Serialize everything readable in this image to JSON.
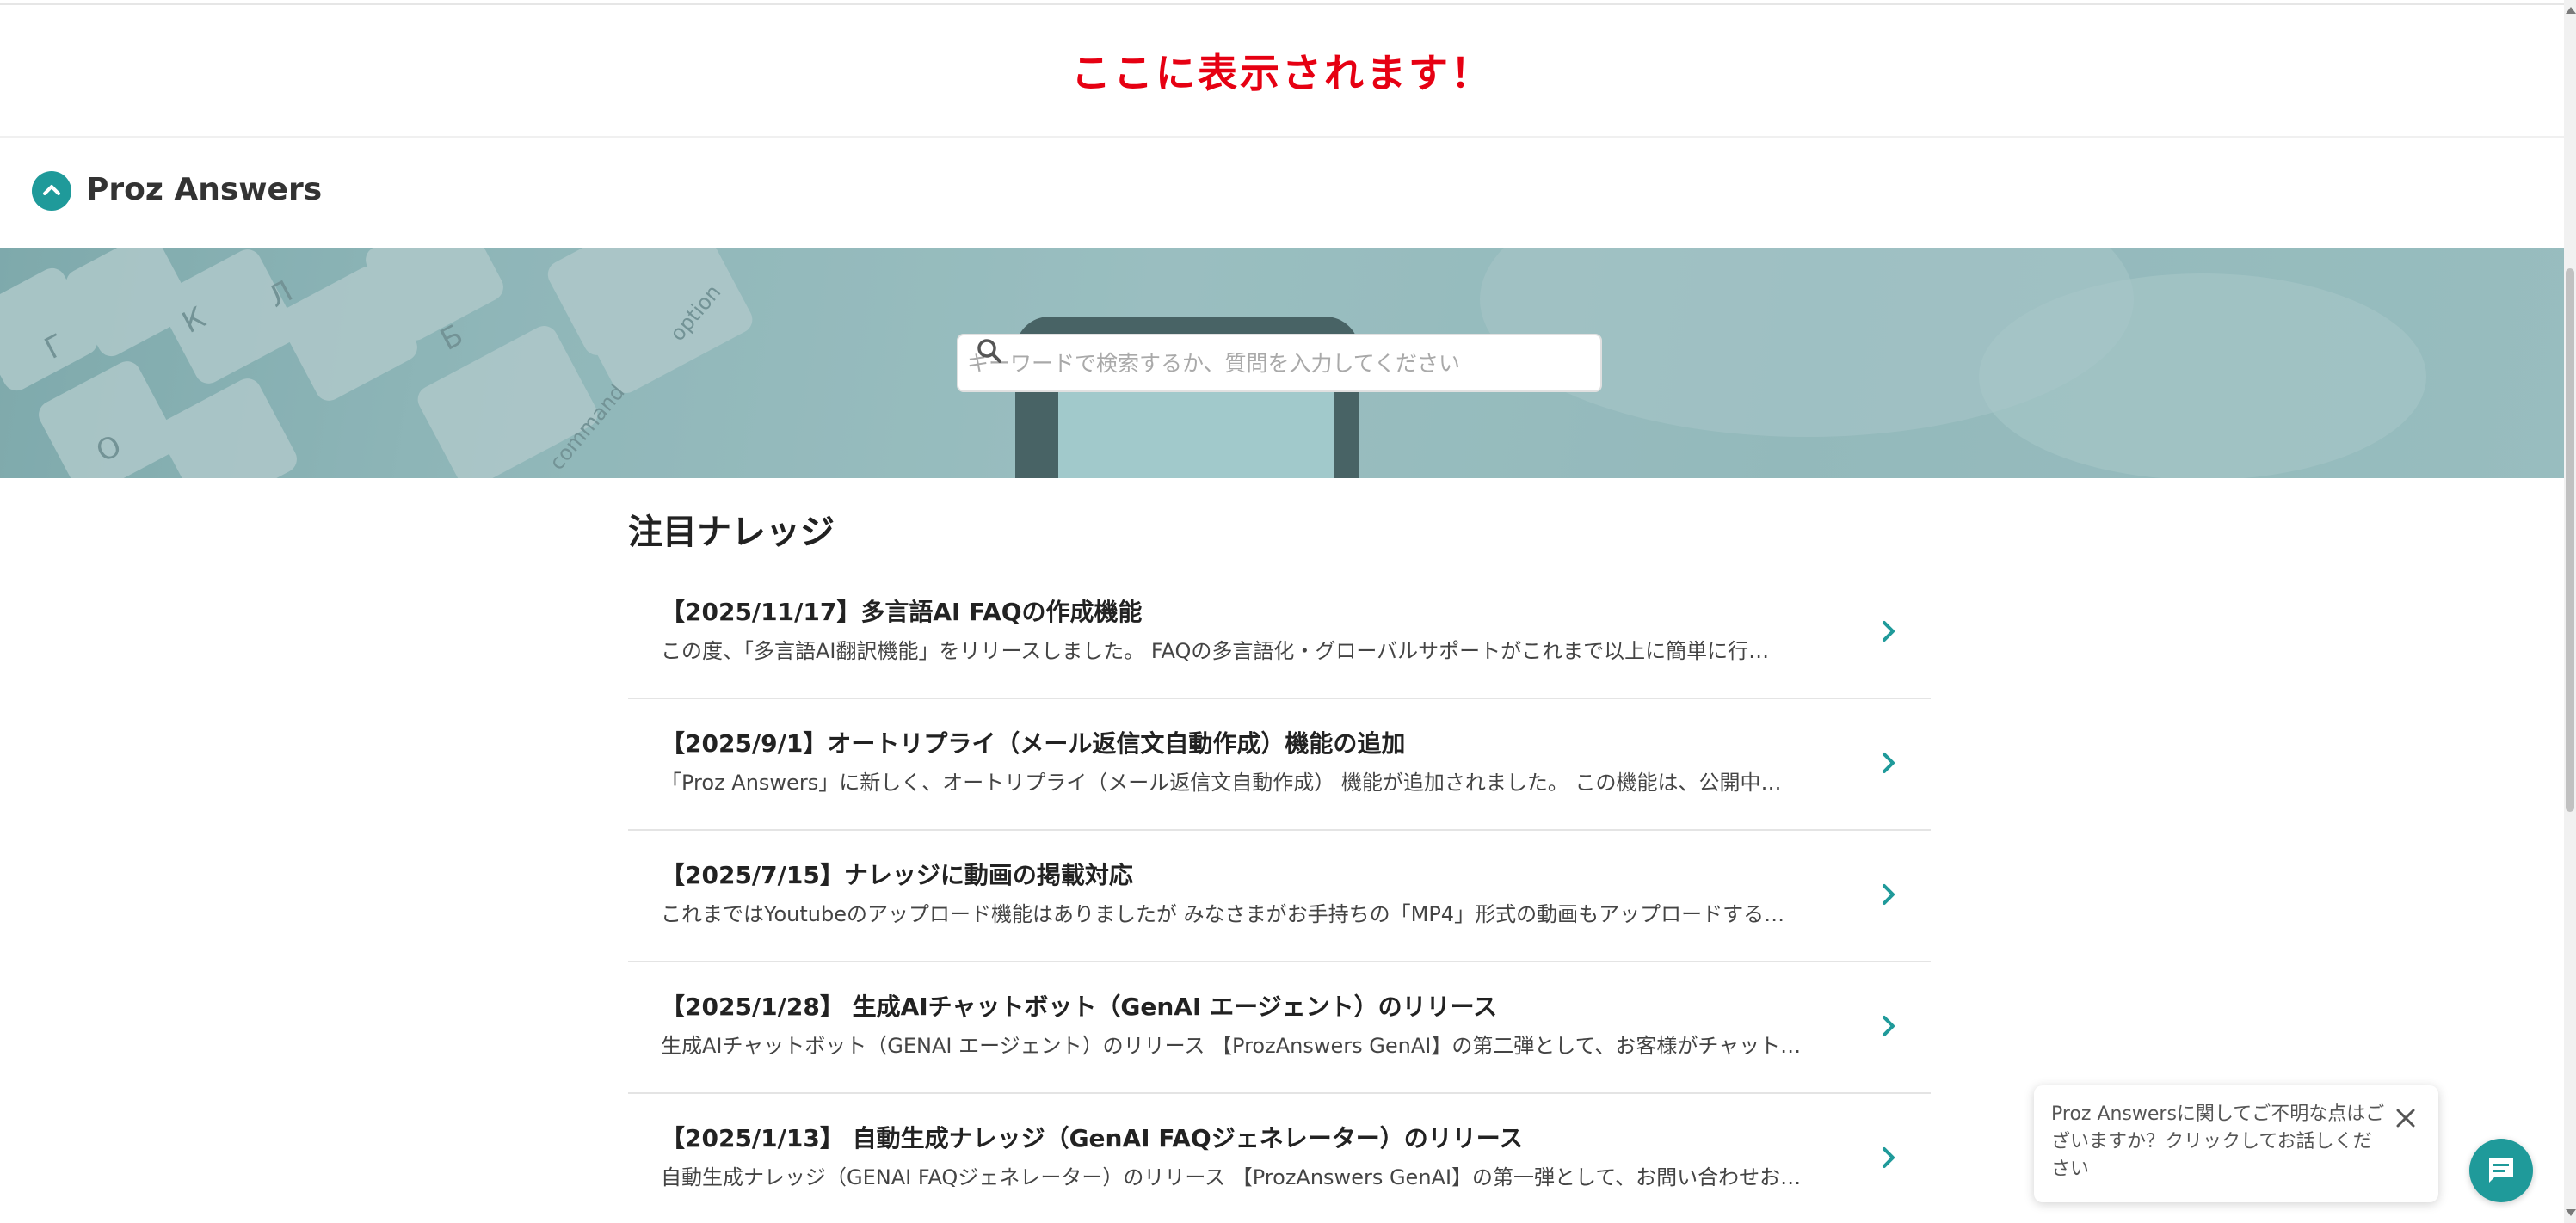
{
  "announcement": {
    "text": "ここに表示されます！"
  },
  "header": {
    "brand": "Proz Answers"
  },
  "search": {
    "placeholder": "キーワードで検索するか、質問を入力してください"
  },
  "featured": {
    "title": "注目ナレッジ",
    "items": [
      {
        "title": "【2025/11/17】多言語AI FAQの作成機能",
        "desc": "この度、「多言語AI翻訳機能」をリリースしました。 FAQの多言語化・グローバルサポートがこれまで以上に簡単に行…"
      },
      {
        "title": "【2025/9/1】オートリプライ（メール返信文自動作成）機能の追加",
        "desc": "「Proz Answers」に新しく、オートリプライ（メール返信文自動作成） 機能が追加されました。 この機能は、公開中…"
      },
      {
        "title": "【2025/7/15】ナレッジに動画の掲載対応",
        "desc": "これまではYoutubeのアップロード機能はありましたが みなさまがお手持ちの「MP4」形式の動画もアップロードする…"
      },
      {
        "title": "【2025/1/28】 生成AIチャットボット（GenAI エージェント）のリリース",
        "desc": "生成AIチャットボット（GENAI エージェント）のリリース 【ProzAnswers GenAI】の第二弾として、お客様がチャット…"
      },
      {
        "title": "【2025/1/13】 自動生成ナレッジ（GenAI FAQジェネレーター）のリリース",
        "desc": "自動生成ナレッジ（GENAI FAQジェネレーター）のリリース 【ProzAnswers GenAI】の第一弾として、お問い合わせお…"
      }
    ]
  },
  "chat": {
    "tooltip": "Proz Answersに関してご不明な点はございますか？クリックしてお話しください"
  },
  "colors": {
    "accent": "#1f9a9a",
    "announce": "#e60012"
  }
}
